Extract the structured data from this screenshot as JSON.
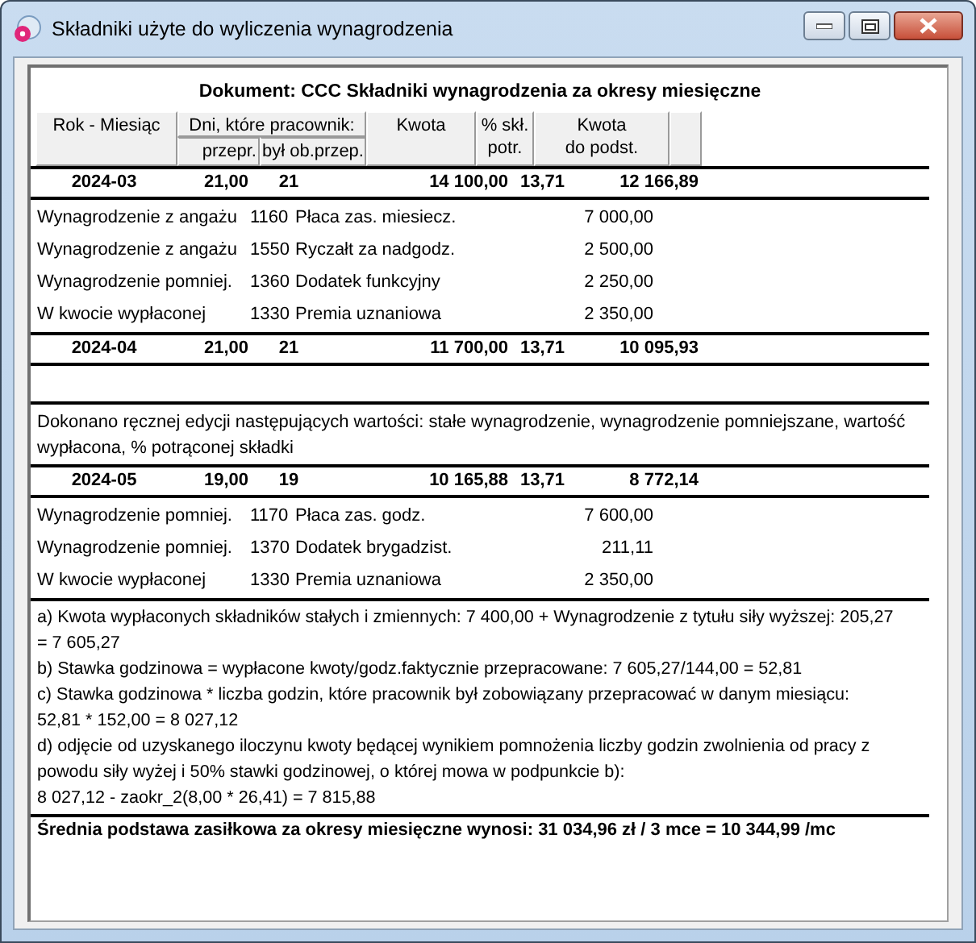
{
  "window": {
    "title": "Składniki użyte do wyliczenia wynagrodzenia"
  },
  "document_title": "Dokument: CCC Składniki wynagrodzenia za okresy miesięczne",
  "header": {
    "month": "Rok - Miesiąc",
    "days": "Dni, które pracownik:",
    "days_worked": "przepr.",
    "days_required": "był ob.przep.",
    "amount": "Kwota",
    "percent": [
      "% skł.",
      "potr."
    ],
    "base": [
      "Kwota",
      "do podst."
    ]
  },
  "months": [
    {
      "month": "2024-03",
      "days_worked": "21,00",
      "days_required": "21",
      "amount": "14 100,00",
      "percent": "13,71",
      "base": "12 166,89",
      "items": [
        {
          "type": "Wynagrodzenie z angażu",
          "code": "1160",
          "name": "Płaca zas. miesiecz.",
          "amount": "7 000,00"
        },
        {
          "type": "Wynagrodzenie z angażu",
          "code": "1550",
          "name": "Ryczałt za nadgodz.",
          "amount": "2 500,00"
        },
        {
          "type": "Wynagrodzenie pomniej.",
          "code": "1360",
          "name": "Dodatek funkcyjny",
          "amount": "2 250,00"
        },
        {
          "type": "W kwocie wypłaconej",
          "code": "1330",
          "name": "Premia uznaniowa",
          "amount": "2 350,00"
        }
      ]
    },
    {
      "month": "2024-04",
      "days_worked": "21,00",
      "days_required": "21",
      "amount": "11 700,00",
      "percent": "13,71",
      "base": "10 095,93"
    },
    {
      "note": "Dokonano ręcznej edycji następujących wartości: stałe wynagrodzenie, wynagrodzenie pomniejszane, wartość wypłacona, % potrąconej składki",
      "month": "2024-05",
      "days_worked": "19,00",
      "days_required": "19",
      "amount": "10 165,88",
      "percent": "13,71",
      "base": "8 772,14",
      "items": [
        {
          "type": "Wynagrodzenie pomniej.",
          "code": "1170",
          "name": "Płaca zas. godz.",
          "amount": "7 600,00"
        },
        {
          "type": "Wynagrodzenie pomniej.",
          "code": "1370",
          "name": "Dodatek brygadzist.",
          "amount": "211,11"
        },
        {
          "type": "W kwocie wypłaconej",
          "code": "1330",
          "name": "Premia uznaniowa",
          "amount": "2 350,00"
        }
      ]
    }
  ],
  "calculation": [
    "a) Kwota wypłaconych składników stałych i zmiennych: 7 400,00 +  Wynagrodzenie z tytułu siły wyższej: 205,27\n= 7 605,27",
    "b) Stawka godzinowa = wypłacone kwoty/godz.faktycznie przepracowane: 7 605,27/144,00 = 52,81",
    "c) Stawka godzinowa * liczba godzin, które pracownik był zobowiązany przepracować w danym miesiącu:\n52,81 * 152,00 = 8 027,12",
    "d) odjęcie od uzyskanego iloczynu kwoty będącej wynikiem pomnożenia liczby godzin zwolnienia od pracy z\npowodu siły wyżej i 50% stawki godzinowej, o której mowa w podpunkcie b):\n8 027,12 - zaokr_2(8,00 * 26,41) = 7 815,88"
  ],
  "summary": "Średnia podstawa zasiłkowa za okresy miesięczne wynosi:  31 034,96 zł / 3 mce = 10 344,99 /mc"
}
